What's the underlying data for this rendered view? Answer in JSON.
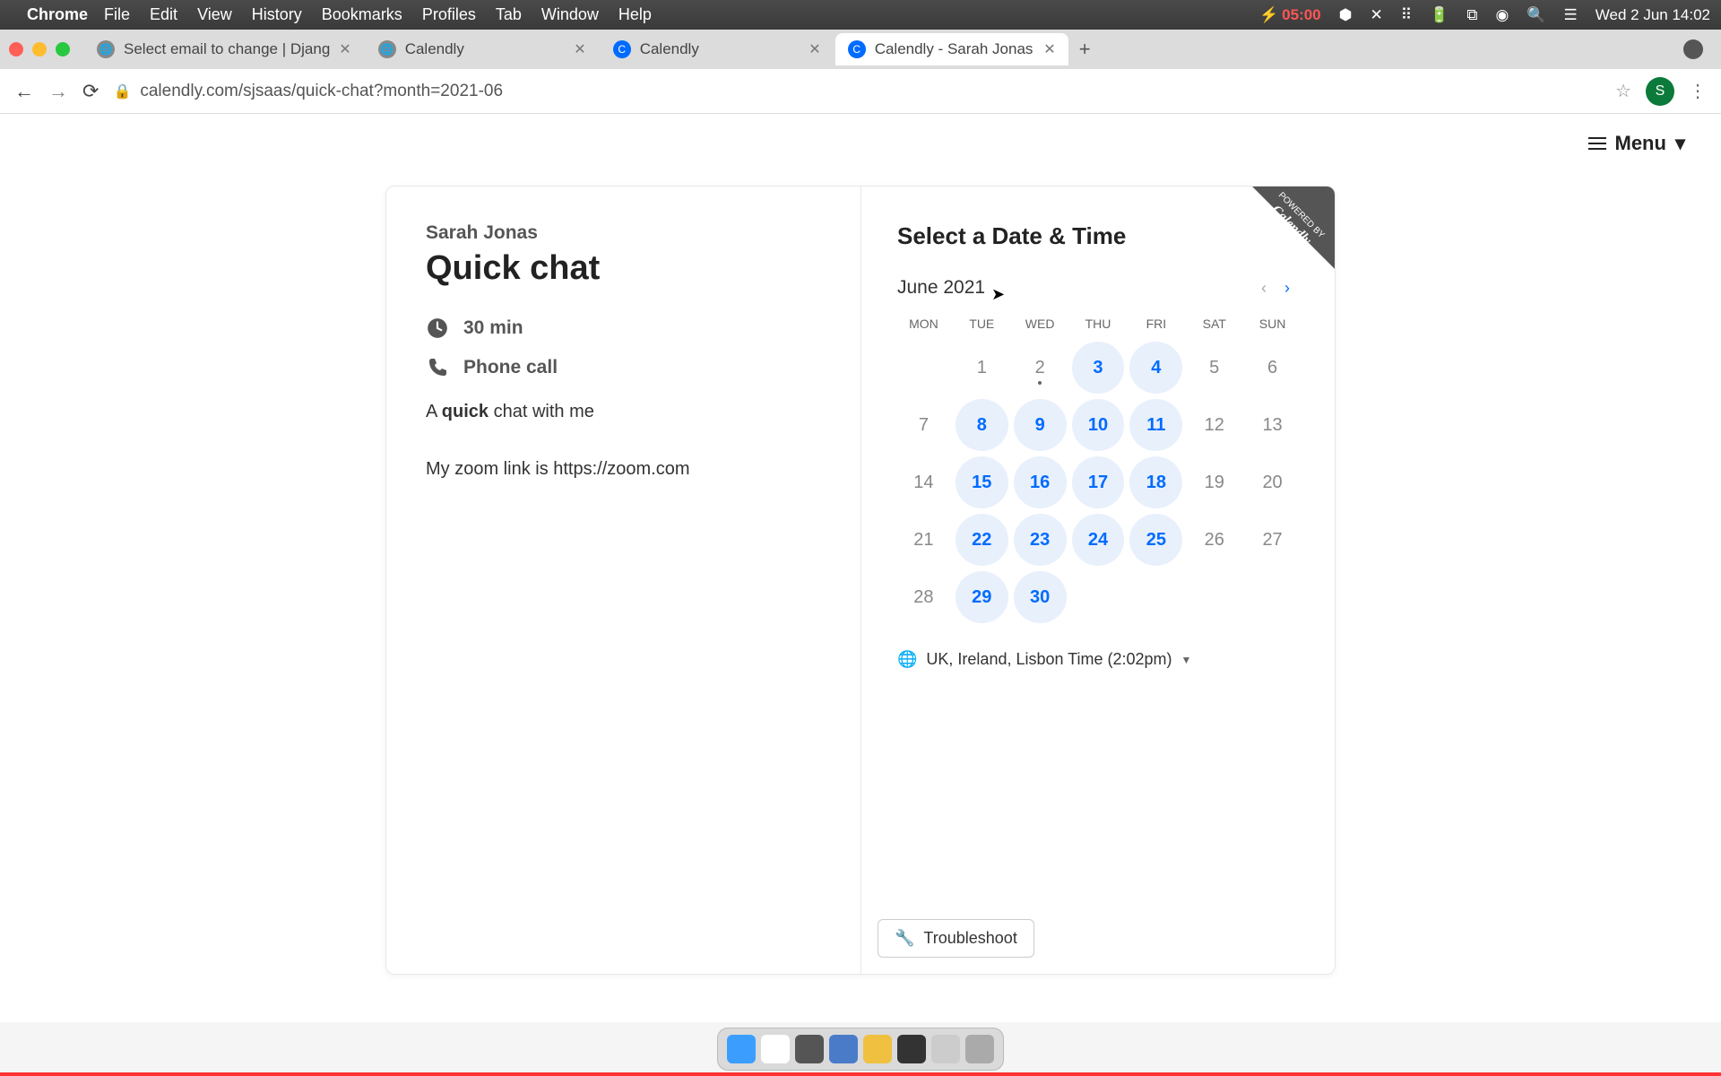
{
  "menubar": {
    "app": "Chrome",
    "items": [
      "File",
      "Edit",
      "View",
      "History",
      "Bookmarks",
      "Profiles",
      "Tab",
      "Window",
      "Help"
    ],
    "battery_time": "05:00",
    "clock": "Wed 2 Jun  14:02"
  },
  "tabs": [
    {
      "title": "Select email to change | Djang",
      "favicon": "globe"
    },
    {
      "title": "Calendly",
      "favicon": "globe"
    },
    {
      "title": "Calendly",
      "favicon": "calendly"
    },
    {
      "title": "Calendly - Sarah Jonas",
      "favicon": "calendly",
      "active": true
    }
  ],
  "url": "calendly.com/sjsaas/quick-chat?month=2021-06",
  "avatar_letter": "S",
  "menu_button": "Menu",
  "event": {
    "host": "Sarah Jonas",
    "name": "Quick chat",
    "duration": "30 min",
    "location": "Phone call",
    "desc_pre": "A ",
    "desc_bold": "quick",
    "desc_post": " chat with me",
    "desc_line2": "My zoom link is https://zoom.com"
  },
  "calendar": {
    "title": "Select a Date & Time",
    "month": "June 2021",
    "badge_small": "POWERED BY",
    "badge_big": "Calendly",
    "weekdays": [
      "MON",
      "TUE",
      "WED",
      "THU",
      "FRI",
      "SAT",
      "SUN"
    ],
    "weeks": [
      [
        {
          "n": ""
        },
        {
          "n": "1"
        },
        {
          "n": "2",
          "today": true
        },
        {
          "n": "3",
          "a": true
        },
        {
          "n": "4",
          "a": true
        },
        {
          "n": "5"
        },
        {
          "n": "6"
        }
      ],
      [
        {
          "n": "7"
        },
        {
          "n": "8",
          "a": true
        },
        {
          "n": "9",
          "a": true
        },
        {
          "n": "10",
          "a": true
        },
        {
          "n": "11",
          "a": true
        },
        {
          "n": "12"
        },
        {
          "n": "13"
        }
      ],
      [
        {
          "n": "14"
        },
        {
          "n": "15",
          "a": true
        },
        {
          "n": "16",
          "a": true
        },
        {
          "n": "17",
          "a": true
        },
        {
          "n": "18",
          "a": true
        },
        {
          "n": "19"
        },
        {
          "n": "20"
        }
      ],
      [
        {
          "n": "21"
        },
        {
          "n": "22",
          "a": true
        },
        {
          "n": "23",
          "a": true
        },
        {
          "n": "24",
          "a": true
        },
        {
          "n": "25",
          "a": true
        },
        {
          "n": "26"
        },
        {
          "n": "27"
        }
      ],
      [
        {
          "n": "28"
        },
        {
          "n": "29",
          "a": true
        },
        {
          "n": "30",
          "a": true
        },
        {
          "n": ""
        },
        {
          "n": ""
        },
        {
          "n": ""
        },
        {
          "n": ""
        }
      ]
    ],
    "timezone": "UK, Ireland, Lisbon Time (2:02pm)",
    "troubleshoot": "Troubleshoot"
  }
}
